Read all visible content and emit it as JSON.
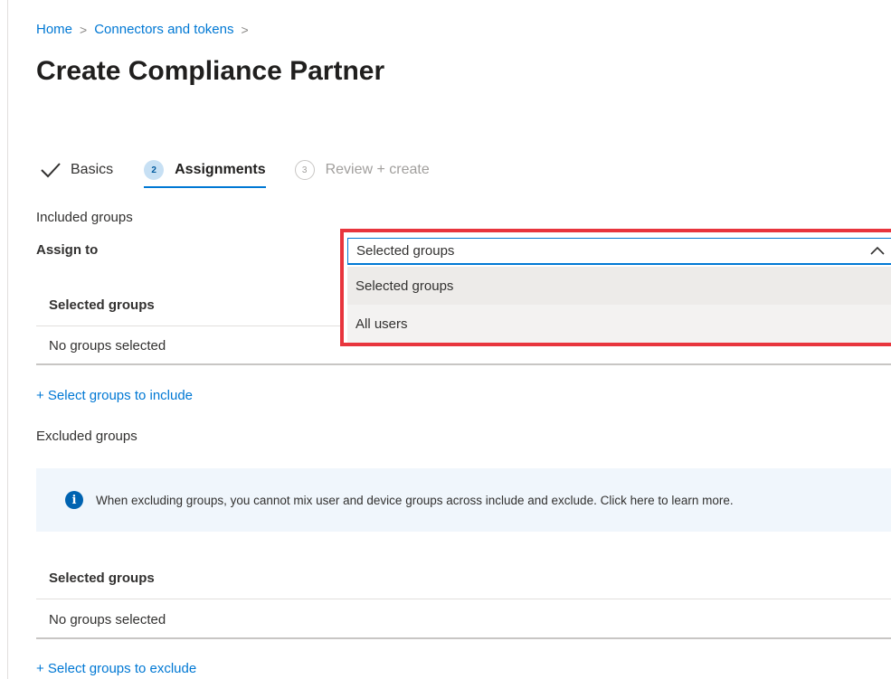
{
  "breadcrumb": {
    "home": "Home",
    "connectors": "Connectors and tokens",
    "separator": ">"
  },
  "page": {
    "title": "Create Compliance Partner"
  },
  "tabs": {
    "basics": {
      "label": "Basics",
      "icon": "checkmark-icon"
    },
    "assignments": {
      "number": "2",
      "label": "Assignments"
    },
    "review": {
      "number": "3",
      "label": "Review + create"
    }
  },
  "included": {
    "heading": "Included groups",
    "assign_to_label": "Assign to",
    "table_header": "Selected groups",
    "empty_text": "No groups selected",
    "add_link": "+ Select groups to include"
  },
  "dropdown": {
    "selected_value": "Selected groups",
    "options": [
      "Selected groups",
      "All users"
    ],
    "highlight_color": "#e8353d",
    "icon": "chevron-up-icon"
  },
  "excluded": {
    "heading": "Excluded groups",
    "info_text": "When excluding groups, you cannot mix user and device groups across include and exclude. Click here to learn more.",
    "info_icon": "info-icon",
    "table_header": "Selected groups",
    "empty_text": "No groups selected",
    "add_link": "+ Select groups to exclude"
  },
  "colors": {
    "accent": "#0078d4",
    "info_background": "#f0f6fc"
  }
}
